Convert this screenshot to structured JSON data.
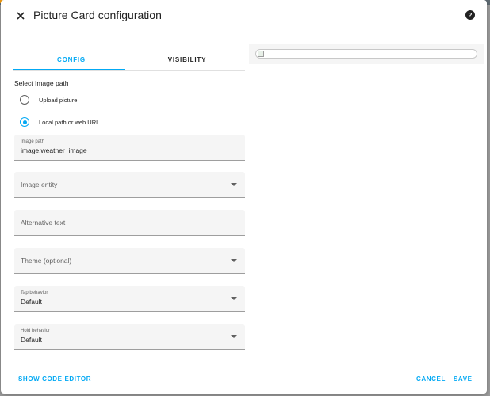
{
  "dialog": {
    "title": "Picture Card configuration",
    "close_icon": "close-icon",
    "help_icon": "help-circle-icon"
  },
  "tabs": [
    {
      "label": "CONFIG",
      "active": true
    },
    {
      "label": "VISIBILITY",
      "active": false
    }
  ],
  "image_source": {
    "label": "Select Image path",
    "options": [
      {
        "label": "Upload picture",
        "checked": false
      },
      {
        "label": "Local path or web URL",
        "checked": true
      }
    ]
  },
  "fields": {
    "image_path": {
      "label": "Image path",
      "value": "image.weather_image"
    },
    "image_entity": {
      "label": "Image entity"
    },
    "alternative_text": {
      "label": "Alternative text"
    },
    "theme": {
      "label": "Theme (optional)"
    },
    "tap_behavior": {
      "label": "Tap behavior",
      "value": "Default"
    },
    "hold_behavior": {
      "label": "Hold behavior",
      "value": "Default"
    }
  },
  "preview": {
    "image_icon": "broken-image-icon"
  },
  "footer": {
    "show_code_editor_label": "SHOW CODE EDITOR",
    "cancel_label": "CANCEL",
    "save_label": "SAVE"
  },
  "colors": {
    "accent": "#03a9f4",
    "field_background": "#f5f5f5",
    "backdrop": "#9e9e9e"
  }
}
